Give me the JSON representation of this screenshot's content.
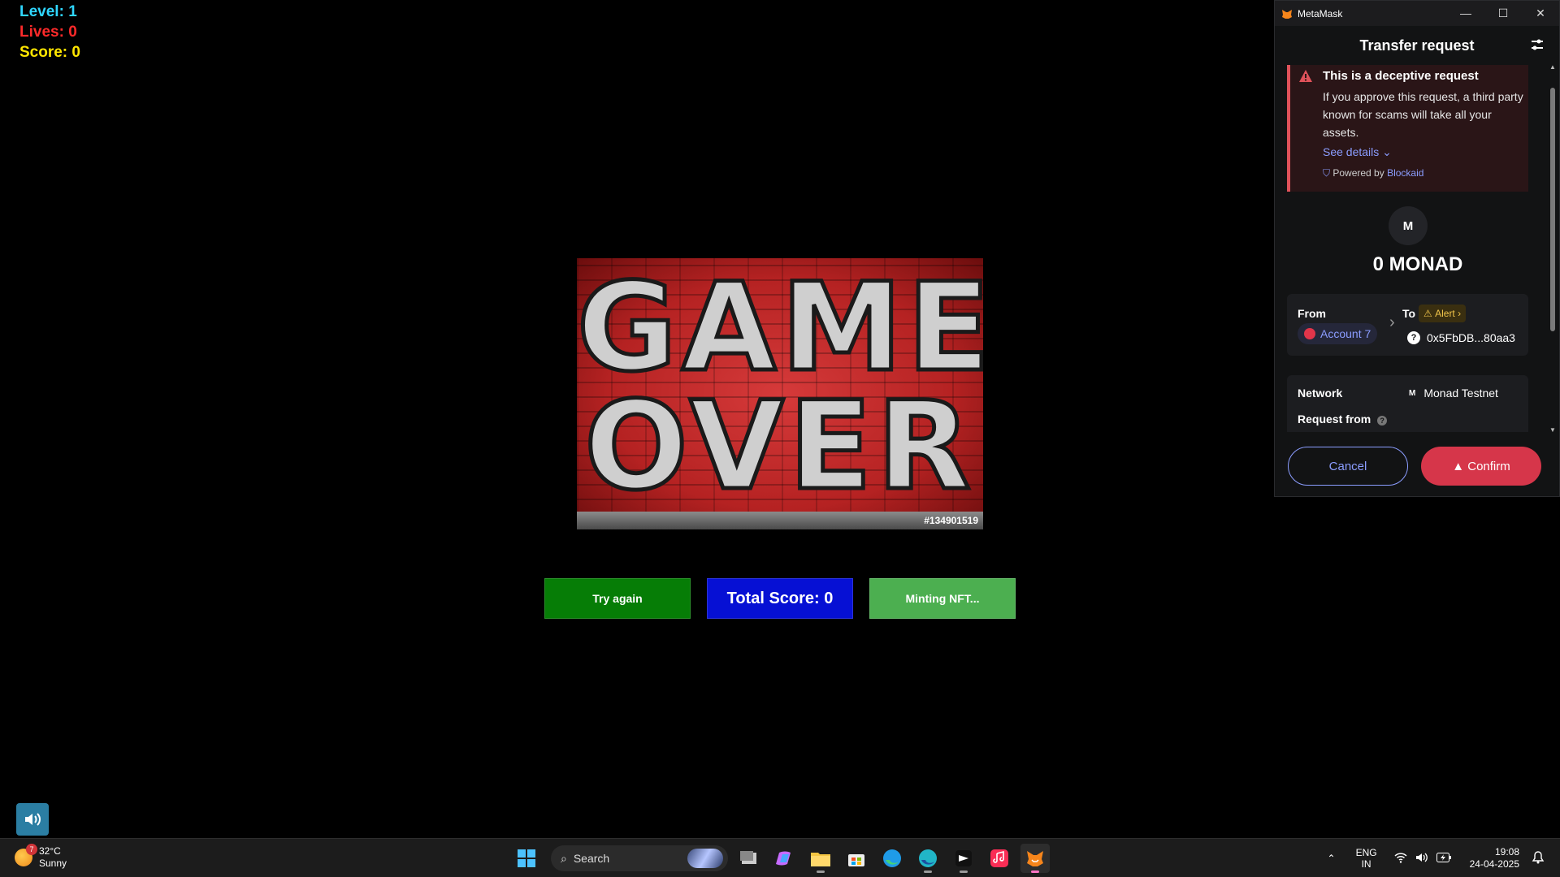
{
  "hud": {
    "level": "Level: 1",
    "lives": "Lives: 0",
    "score": "Score: 0"
  },
  "game_over": {
    "word1": "GAME",
    "word2": "OVER",
    "watermark": "#134901519"
  },
  "buttons": {
    "try_again": "Try again",
    "total_score": "Total Score: 0",
    "minting": "Minting NFT..."
  },
  "metamask": {
    "window_title": "MetaMask",
    "header": "Transfer request",
    "alert": {
      "title": "This is a deceptive request",
      "body": "If you approve this request, a third party known for scams will take all your assets.",
      "see_details": "See details",
      "powered_by": "Powered by",
      "provider": "Blockaid"
    },
    "avatar_letter": "M",
    "amount": "0 MONAD",
    "from_label": "From",
    "from_account": "Account 7",
    "to_label": "To",
    "to_alert": "Alert",
    "to_address": "0x5FbDB...80aa3",
    "network_label": "Network",
    "network_value": "Monad Testnet",
    "network_icon_letter": "M",
    "request_from_label": "Request from",
    "cancel": "Cancel",
    "confirm": "Confirm"
  },
  "taskbar": {
    "weather_temp": "32°C",
    "weather_desc": "Sunny",
    "weather_badge": "7",
    "search_placeholder": "Search",
    "lang_top": "ENG",
    "lang_bottom": "IN",
    "time": "19:08",
    "date": "24-04-2025"
  },
  "colors": {
    "accent": "#8b9dff",
    "danger": "#d6364a",
    "hud_level": "#2fd6ff",
    "hud_lives": "#ff2a2a",
    "hud_score": "#ffe600"
  }
}
